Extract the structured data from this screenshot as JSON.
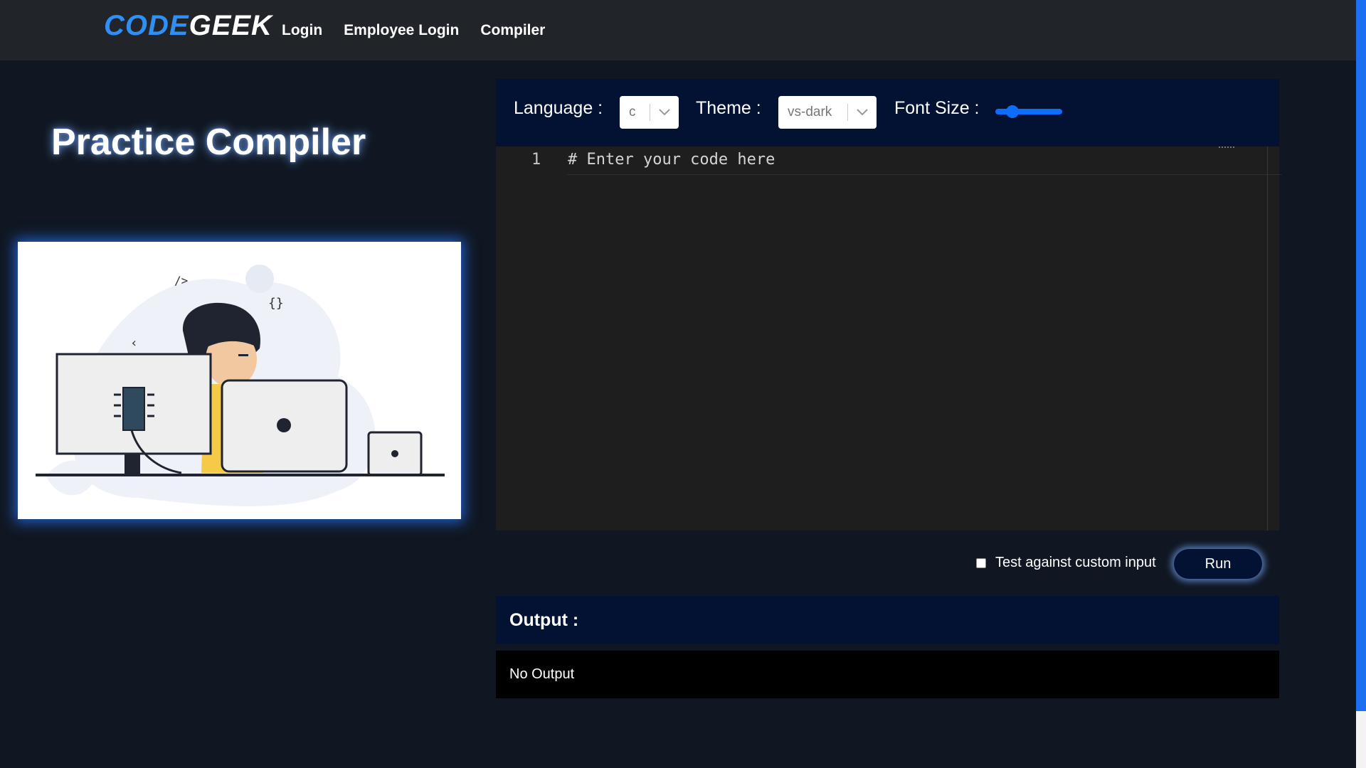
{
  "nav": {
    "brand_part1": "CODE",
    "brand_part2": "GEEK",
    "links": [
      "Login",
      "Employee Login",
      "Compiler"
    ]
  },
  "main": {
    "title": "Practice Compiler"
  },
  "toolbar": {
    "language_label": "Language :",
    "language_value": "c",
    "theme_label": "Theme :",
    "theme_value": "vs-dark",
    "font_size_label": "Font Size :",
    "font_size_level": 0.2
  },
  "editor": {
    "line_number": "1",
    "code": "# Enter your code here"
  },
  "run_row": {
    "checkbox_label": "Test against custom input",
    "checkbox_checked": false,
    "run_label": "Run"
  },
  "output": {
    "header": "Output :",
    "text": "No Output"
  },
  "colors": {
    "background": "#101722",
    "navbar": "#212529",
    "panel": "#031233",
    "brand_blue": "#2f8ff5",
    "editor_bg": "#1e1e1e"
  }
}
